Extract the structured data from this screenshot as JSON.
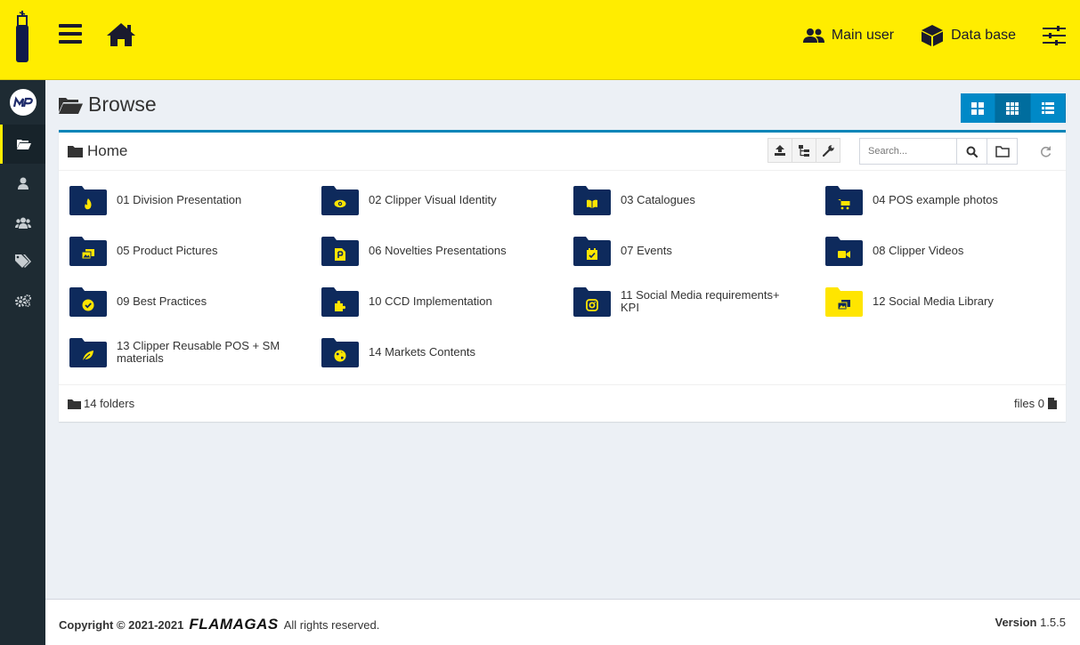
{
  "header": {
    "user_label": "Main user",
    "database_label": "Data base"
  },
  "page": {
    "title": "Browse"
  },
  "browser": {
    "breadcrumb": "Home",
    "search_placeholder": "Search...",
    "folders": [
      {
        "name": "01 Division Presentation",
        "icon": "fire-icon",
        "color": "#0e2a5c"
      },
      {
        "name": "02 Clipper Visual Identity",
        "icon": "eye-icon",
        "color": "#0e2a5c"
      },
      {
        "name": "03 Catalogues",
        "icon": "book-icon",
        "color": "#0e2a5c"
      },
      {
        "name": "04 POS example photos",
        "icon": "cart-icon",
        "color": "#0e2a5c"
      },
      {
        "name": "05 Product Pictures",
        "icon": "images-icon",
        "color": "#0e2a5c"
      },
      {
        "name": "06 Novelties Presentations",
        "icon": "powerpoint-icon",
        "color": "#0e2a5c"
      },
      {
        "name": "07 Events",
        "icon": "calendar-check-icon",
        "color": "#0e2a5c"
      },
      {
        "name": "08 Clipper Videos",
        "icon": "video-icon",
        "color": "#0e2a5c"
      },
      {
        "name": "09 Best Practices",
        "icon": "check-circle-icon",
        "color": "#0e2a5c"
      },
      {
        "name": "10 CCD Implementation",
        "icon": "puzzle-icon",
        "color": "#0e2a5c"
      },
      {
        "name": "11 Social Media requirements+ KPI",
        "icon": "instagram-icon",
        "color": "#0e2a5c"
      },
      {
        "name": "12 Social Media Library",
        "icon": "images-icon",
        "color": "#ffe500"
      },
      {
        "name": "13 Clipper Reusable POS + SM materials",
        "icon": "leaf-icon",
        "color": "#0e2a5c"
      },
      {
        "name": "14 Markets Contents",
        "icon": "globe-icon",
        "color": "#0e2a5c"
      }
    ],
    "folders_count_label": "14 folders",
    "files_count_label": "files 0"
  },
  "footer": {
    "copyright": "Copyright © 2021-2021",
    "brand": "FLAMAGAS",
    "rights": "All rights reserved.",
    "version_label": "Version",
    "version_value": "1.5.5"
  },
  "colors": {
    "header_bg": "#ffed00",
    "sidebar_bg": "#1e2b33",
    "folder_navy": "#0e2a5c",
    "accent_blue": "#0089c7"
  }
}
